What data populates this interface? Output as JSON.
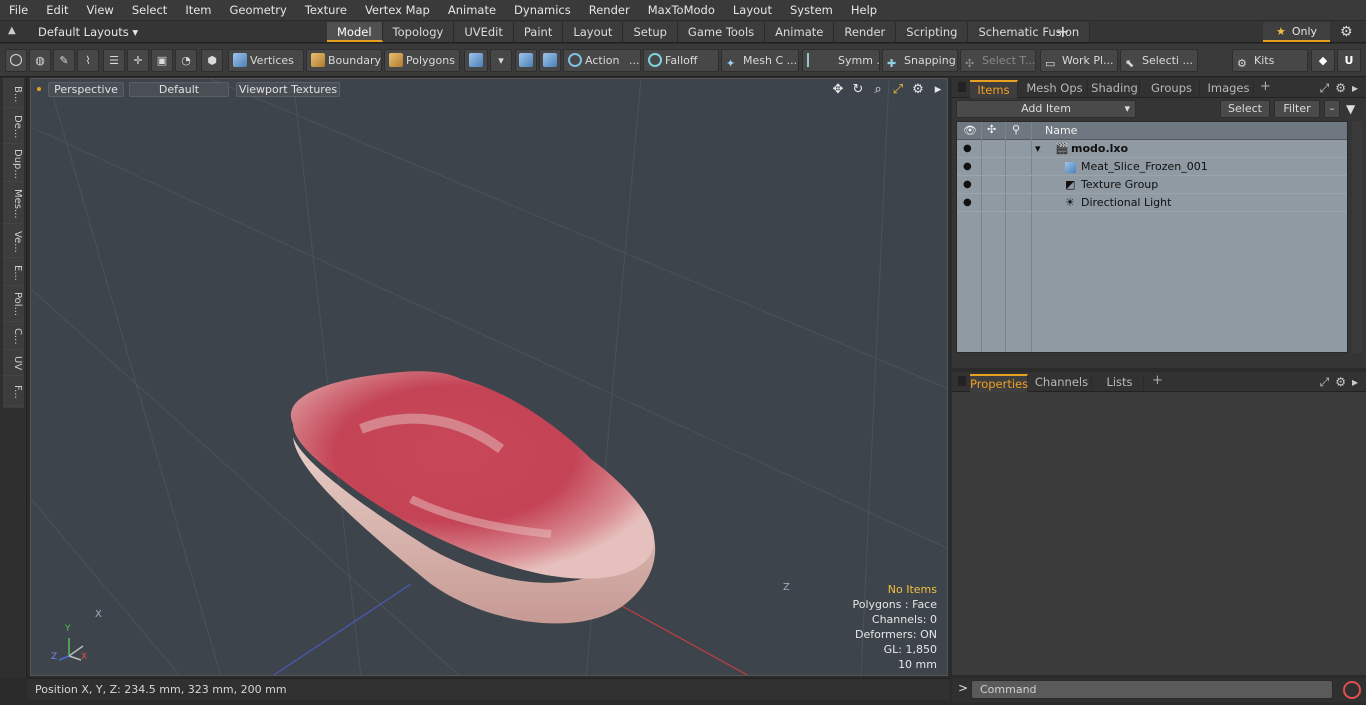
{
  "menu": [
    "File",
    "Edit",
    "View",
    "Select",
    "Item",
    "Geometry",
    "Texture",
    "Vertex Map",
    "Animate",
    "Dynamics",
    "Render",
    "MaxToModo",
    "Layout",
    "System",
    "Help"
  ],
  "layouts_label": "Default Layouts ▾",
  "layout_tabs": [
    "Model",
    "Topology",
    "UVEdit",
    "Paint",
    "Layout",
    "Setup",
    "Game Tools",
    "Animate",
    "Render",
    "Scripting",
    "Schematic Fusion"
  ],
  "active_layout_tab": "Model",
  "only_label": "Only",
  "toolbar": {
    "vertices": "Vertices",
    "boundary": "Boundary",
    "polygons": "Polygons",
    "action": "Action",
    "action_more": "...",
    "falloff": "Falloff",
    "mesh": "Mesh C ...",
    "symm": "Symm ...",
    "snapping": "Snapping",
    "select_t": "Select T...",
    "work_pl": "Work Pl...",
    "selecti": "Selecti ...",
    "kits": "Kits"
  },
  "left_tabs": [
    "B...",
    "De...",
    "Dup...",
    "Mes...",
    "Ve...",
    "E...",
    "Pol...",
    "C...",
    "UV",
    "F..."
  ],
  "viewport": {
    "view": "Perspective",
    "shading": "Default",
    "textures": "Viewport Textures",
    "info": {
      "no_items": "No Items",
      "polygons": "Polygons : Face",
      "channels": "Channels: 0",
      "deformers": "Deformers: ON",
      "gl": "GL: 1,850",
      "scale": "10 mm"
    },
    "axis": {
      "x": "X",
      "y": "Y",
      "z": "Z"
    },
    "corner_labels": {
      "x": "X",
      "z": "Z"
    }
  },
  "status": "Position X, Y, Z:   234.5 mm, 323 mm, 200 mm",
  "items_panel": {
    "tabs": [
      "Items",
      "Mesh Ops",
      "Shading",
      "Groups",
      "Images"
    ],
    "add_item": "Add Item",
    "select": "Select",
    "filter": "Filter",
    "column_name": "Name",
    "tree": [
      {
        "label": "modo.lxo",
        "bold": true,
        "icon": "scene-icon"
      },
      {
        "label": "Meat_Slice_Frozen_001",
        "bold": false,
        "icon": "mesh-icon"
      },
      {
        "label": "Texture Group",
        "bold": false,
        "icon": "texture-group-icon"
      },
      {
        "label": "Directional Light",
        "bold": false,
        "icon": "light-icon"
      }
    ]
  },
  "properties_panel": {
    "tabs": [
      "Properties",
      "Channels",
      "Lists"
    ]
  },
  "command": {
    "prompt": ">",
    "placeholder": "Command"
  },
  "colors": {
    "accent": "#e8a020",
    "meat": "#c8485a",
    "info_highlight": "#f0c040"
  }
}
